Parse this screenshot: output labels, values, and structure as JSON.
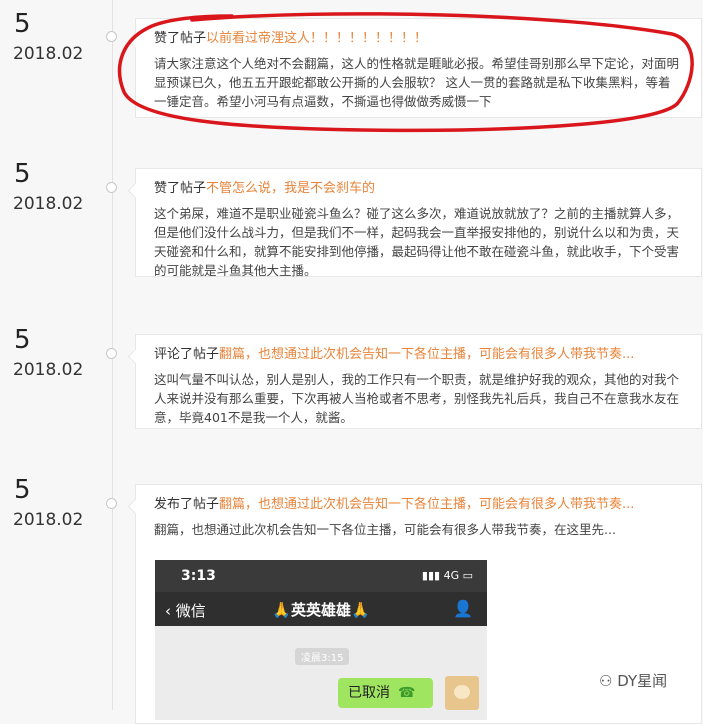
{
  "entries": [
    {
      "day": "5",
      "ym": "2018.02",
      "action": "赞了帖子",
      "title": "以前看过帝浬这人！！！！！！！！！",
      "body": "请大家注意这个人绝对不会翻篇，这人的性格就是睚眦必报。希望佳哥别那么早下定论，对面明显预谋已久，他五五开跟蛇都敢公开撕的人会服软？ 这人一贯的套路就是私下收集黑料，等着一锤定音。希望小河马有点逼数，不撕逼也得做做秀威慑一下"
    },
    {
      "day": "5",
      "ym": "2018.02",
      "action": "赞了帖子",
      "title": "不管怎么说，我是不会刹车的",
      "body": "这个弟屎，难道不是职业碰瓷斗鱼么？碰了这么多次，难道说放就放了？之前的主播就算人多，但是他们没什么战斗力，但是我们不一样，起码我会一直举报安排他的，别说什么以和为贵，天天碰瓷和什么和，就算不能安排到他停播，最起码得让他不敢在碰瓷斗鱼，就此收手，下个受害的可能就是斗鱼其他大主播。"
    },
    {
      "day": "5",
      "ym": "2018.02",
      "action": "评论了帖子",
      "title": "翻篇，也想通过此次机会告知一下各位主播，可能会有很多人带我节奏...",
      "body": "这叫气量不叫认怂，别人是别人，我的工作只有一个职责，就是维护好我的观众，其他的对我个人来说并没有那么重要，下次再被人当枪或者不思考，别怪我先礼后兵，我自己不在意我水友在意，毕竟401不是我一个人，就酱。"
    },
    {
      "day": "5",
      "ym": "2018.02",
      "action": "发布了帖子",
      "title": "翻篇，也想通过此次机会告知一下各位主播，可能会有很多人带我节奏...",
      "body": "翻篇，也想通过此次机会告知一下各位主播，可能会有很多人带我节奏，在这里先..."
    }
  ],
  "chat": {
    "time": "3:13",
    "signal": "4G",
    "back": "微信",
    "title": "英英雄雄",
    "stamp": "凌晨3:15",
    "bubble": "已取消"
  },
  "watermark": "DY星闻",
  "colors": {
    "title": "#e8843a",
    "circle": "#d9161b",
    "bubble": "#9fe55f"
  }
}
